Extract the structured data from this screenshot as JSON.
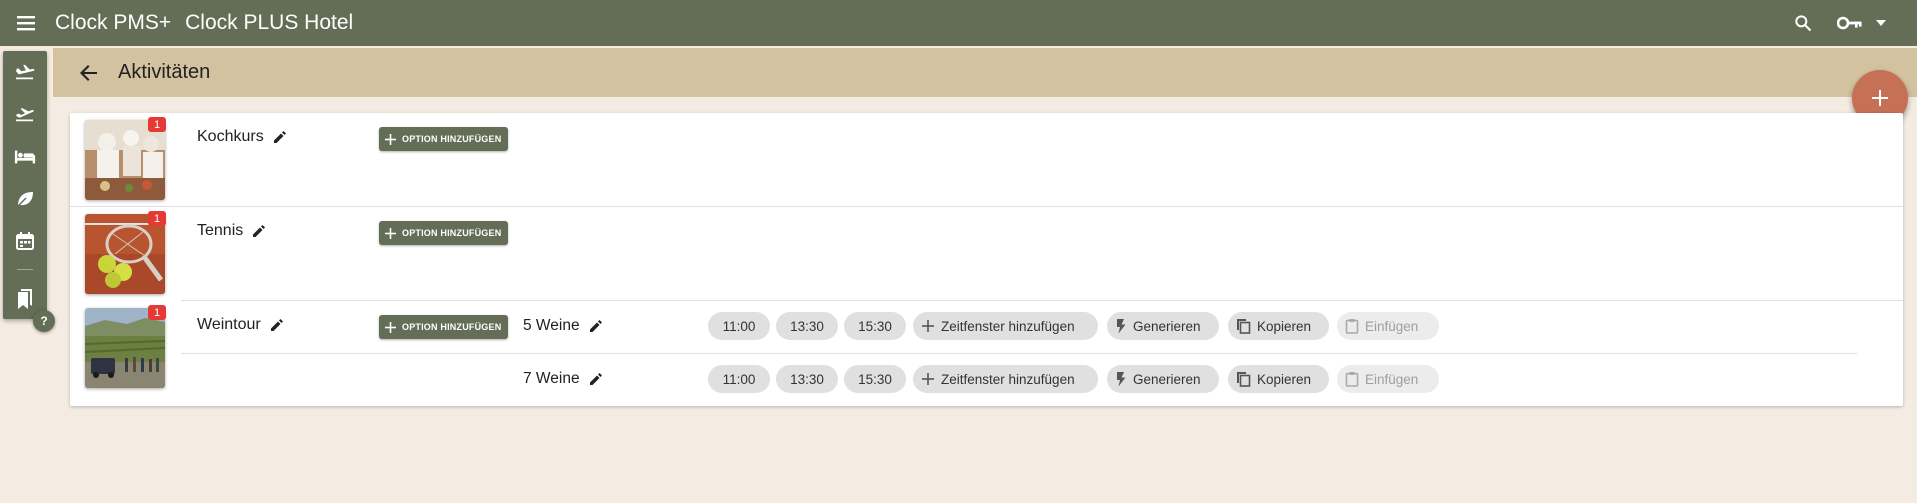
{
  "app": {
    "name": "Clock PMS+",
    "hotel": "Clock PLUS Hotel"
  },
  "header": {
    "menu_icon": "menu-icon",
    "search_icon": "search-icon",
    "key_icon": "key-icon",
    "dropdown_icon": "caret-down-icon"
  },
  "side_rail": {
    "items": [
      {
        "icon": "arrivals-icon"
      },
      {
        "icon": "departures-icon"
      },
      {
        "icon": "bed-icon"
      },
      {
        "icon": "leaf-icon"
      },
      {
        "icon": "calendar-icon"
      },
      {
        "icon": "bookmarks-icon"
      }
    ],
    "help_label": "?"
  },
  "subheader": {
    "title": "Aktivitäten",
    "back_icon": "arrow-back-icon"
  },
  "fab": {
    "icon": "add-icon"
  },
  "activities": [
    {
      "name": "Kochkurs",
      "badge": "1",
      "add_option_label": "OPTION HINZUFÜGEN",
      "options": []
    },
    {
      "name": "Tennis",
      "badge": "1",
      "add_option_label": "OPTION HINZUFÜGEN",
      "options": []
    },
    {
      "name": "Weintour",
      "badge": "1",
      "add_option_label": "OPTION HINZUFÜGEN",
      "options": [
        {
          "name": "5 Weine",
          "times": [
            "11:00",
            "13:30",
            "15:30"
          ],
          "add_time_label": "Zeitfenster hinzufügen",
          "generate_label": "Generieren",
          "copy_label": "Kopieren",
          "paste_label": "Einfügen"
        },
        {
          "name": "7 Weine",
          "times": [
            "11:00",
            "13:30",
            "15:30"
          ],
          "add_time_label": "Zeitfenster hinzufügen",
          "generate_label": "Generieren",
          "copy_label": "Kopieren",
          "paste_label": "Einfügen"
        }
      ]
    }
  ],
  "colors": {
    "primary": "#646d55",
    "subheader": "#d2c2a0",
    "background": "#f4ece2",
    "accent": "#c67055",
    "badge": "#e53935"
  }
}
